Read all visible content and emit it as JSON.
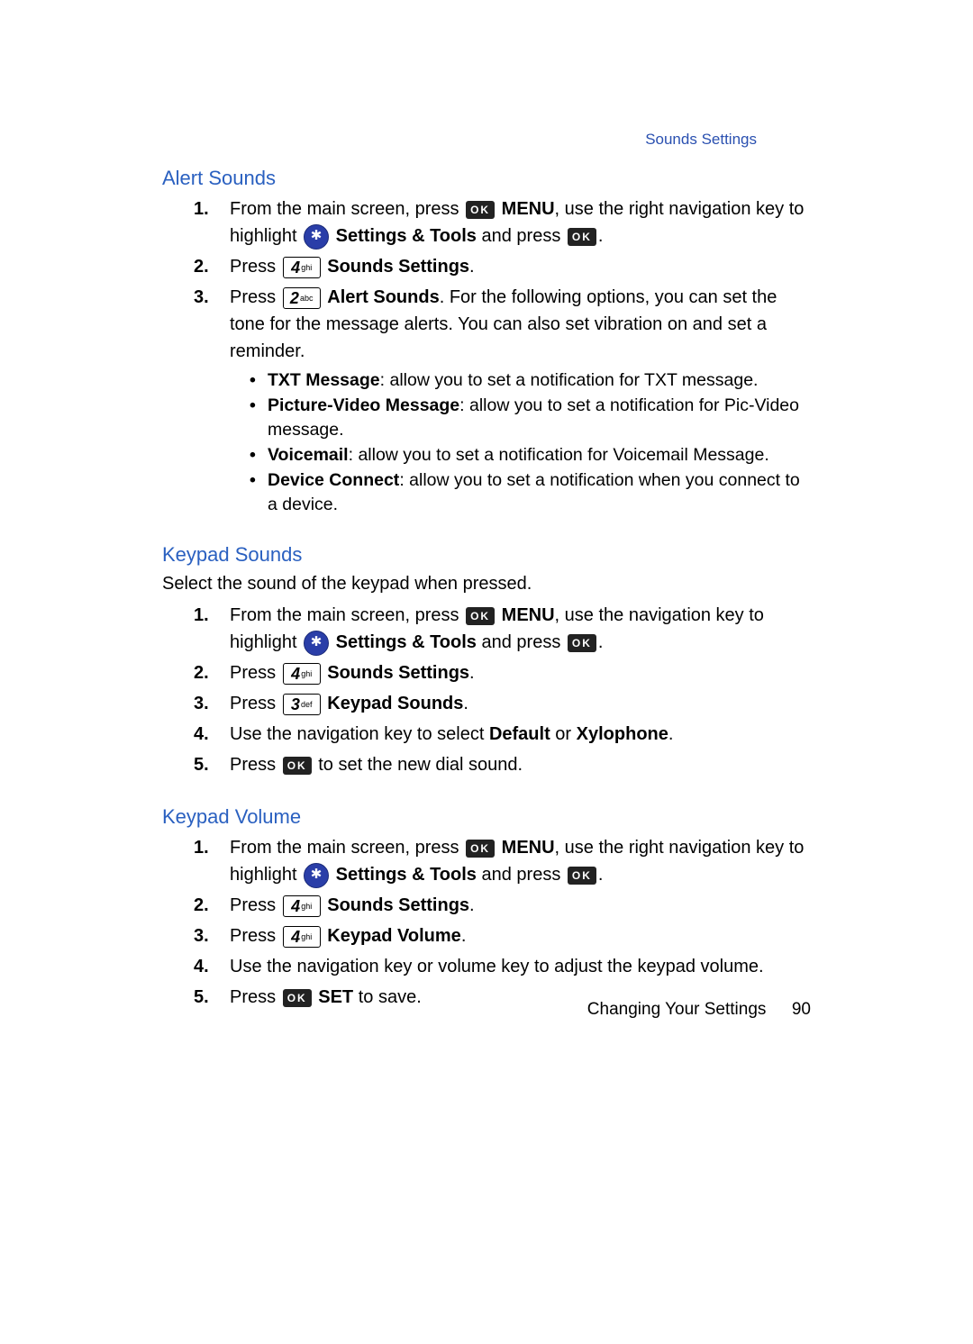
{
  "header": {
    "link": "Sounds Settings"
  },
  "sections": {
    "alert": {
      "title": "Alert Sounds",
      "step1_a": "From the main screen, press ",
      "menu": "MENU",
      "step1_b": ", use the right navigation key to highlight ",
      "tools": "Settings & Tools",
      "andpress": " and press ",
      "step2_a": "Press ",
      "sounds_settings": "Sounds Settings",
      "step3_a": "Press ",
      "alert_sounds": "Alert Sounds",
      "step3_b": ". For the following options, you can set the tone for the message alerts. You can also set vibration on and set a reminder.",
      "b1_bold": "TXT Message",
      "b1_text": ": allow you to set a notification for TXT message.",
      "b2_bold": "Picture-Video Message",
      "b2_text": ": allow you to set a notification for Pic-Video message.",
      "b3_bold": "Voicemail",
      "b3_text": ": allow you to set a notification for Voicemail Message.",
      "b4_bold": "Device Connect",
      "b4_text": ": allow you to set a notification when you connect to a device."
    },
    "keypad_sounds": {
      "title": "Keypad Sounds",
      "lead": "Select the sound of the keypad when pressed.",
      "step1_a": "From the main screen, press ",
      "menu": "MENU",
      "step1_b": ", use the navigation key to highlight ",
      "tools": "Settings & Tools",
      "andpress": " and press ",
      "step2_a": "Press ",
      "sounds_settings": "Sounds Settings",
      "step3_a": "Press ",
      "keypad_sounds": "Keypad Sounds",
      "step4_a": "Use the navigation key to select ",
      "default": "Default",
      "or": " or ",
      "xylo": "Xylophone",
      "step5_a": "Press ",
      "step5_b": " to set the new dial sound."
    },
    "keypad_volume": {
      "title": "Keypad Volume",
      "step1_a": "From the main screen, press ",
      "menu": "MENU",
      "step1_b": ", use the right navigation key to highlight ",
      "tools": "Settings & Tools",
      "andpress": " and press ",
      "step2_a": "Press ",
      "sounds_settings": "Sounds Settings",
      "step3_a": "Press ",
      "keypad_volume": "Keypad Volume",
      "step4": "Use the navigation key or volume key to adjust the keypad volume.",
      "step5_a": "Press ",
      "set": "SET",
      "step5_b": " to save."
    }
  },
  "keys": {
    "ok": "OK",
    "k2": {
      "d": "2",
      "l": "abc"
    },
    "k3": {
      "d": "3",
      "l": "def"
    },
    "k4": {
      "d": "4",
      "l": "ghi"
    }
  },
  "footer": {
    "section": "Changing Your Settings",
    "page": "90"
  }
}
